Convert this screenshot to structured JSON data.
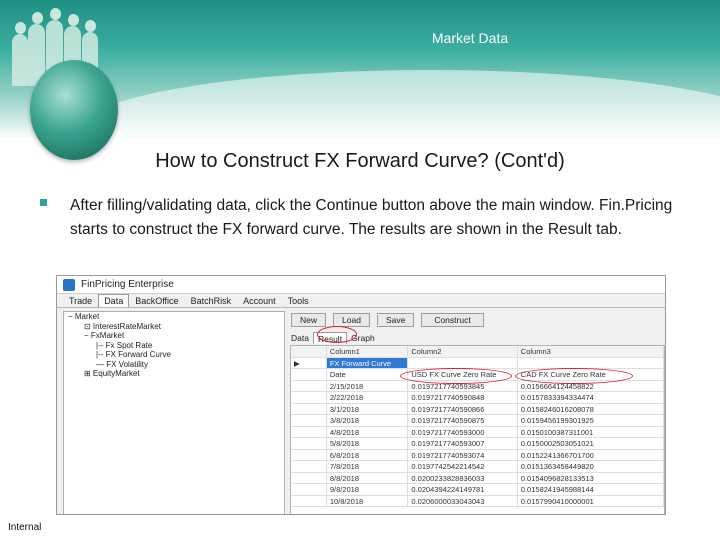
{
  "slide": {
    "header_title": "Market Data",
    "title": "How to Construct FX Forward Curve? (Cont'd)",
    "bullet": "After filling/validating data, click the Continue button above the main window. Fin.Pricing starts to construct the FX forward curve. The results are shown in the Result tab.",
    "footer": "Internal"
  },
  "app": {
    "window_title": "FinPricing Enterprise",
    "menu_tabs": [
      "Trade",
      "Data",
      "BackOffice",
      "BatchRisk",
      "Account",
      "Tools"
    ],
    "active_menu": "Data",
    "tree": [
      "− Market",
      "⊡ InterestRateMarket",
      "− FxMarket",
      "|-- Fx Spot Rate",
      "|-- FX Forward Curve",
      "— FX Volatility",
      "⊞ EquityMarket"
    ],
    "toolbar": [
      "New",
      "Load",
      "Save",
      "Construct"
    ],
    "result_tabs": [
      "Data",
      "Result",
      "Graph"
    ],
    "active_result_tab": "Result",
    "grid": {
      "columns": [
        "",
        "Column1",
        "Column2",
        "Column3"
      ],
      "rows": [
        [
          "▶",
          "FX Forward Curve",
          "",
          ""
        ],
        [
          "",
          "Date",
          "USD FX Curve Zero Rate",
          "CAD FX Curve Zero Rate"
        ],
        [
          "",
          "2/15/2018",
          "0.0197217740593845",
          "0.0156664124458822"
        ],
        [
          "",
          "2/22/2018",
          "0.0197217740590848",
          "0.0157833394334474"
        ],
        [
          "",
          "3/1/2018",
          "0.0197217740590866",
          "0.0158246016208078"
        ],
        [
          "",
          "3/8/2018",
          "0.0197217740590875",
          "0.0159456199301925"
        ],
        [
          "",
          "4/8/2018",
          "0.0197217740593000",
          "0.0150100387311001"
        ],
        [
          "",
          "5/8/2018",
          "0.0197217740593007",
          "0.0150002503051021"
        ],
        [
          "",
          "6/8/2018",
          "0.0197217740593074",
          "0.0152241366701700"
        ],
        [
          "",
          "7/8/2018",
          "0.0197742542214542",
          "0.0151363458449820"
        ],
        [
          "",
          "8/8/2018",
          "0.0200233828836033",
          "0.0154096828133513"
        ],
        [
          "",
          "9/8/2018",
          "0.0204394224149781",
          "0.0158241945988144"
        ],
        [
          "",
          "10/8/2018",
          "0.0206000033043043",
          "0.0157990410000001"
        ]
      ]
    }
  }
}
